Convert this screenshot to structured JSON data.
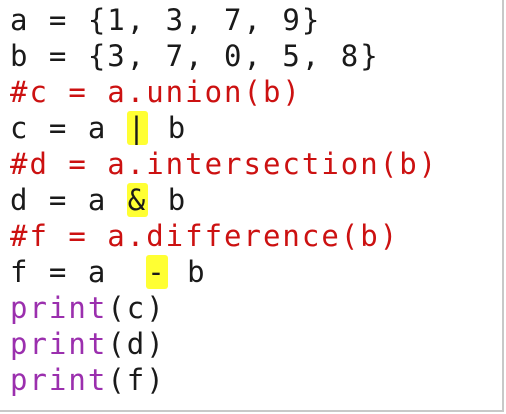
{
  "colors": {
    "default": "#1a1a1a",
    "comment": "#cc1111",
    "builtin": "#9b2fae",
    "highlight": "#ffff33"
  },
  "code_lines": [
    {
      "kind": "default",
      "segments": [
        {
          "text": "a = {1, 3, 7, 9}"
        }
      ]
    },
    {
      "kind": "default",
      "segments": [
        {
          "text": "b = {3, 7, 0, 5, 8}"
        }
      ]
    },
    {
      "kind": "comment",
      "segments": [
        {
          "text": "#c = a.union(b)"
        }
      ]
    },
    {
      "kind": "default",
      "segments": [
        {
          "text": "c = a "
        },
        {
          "text": "|",
          "highlight": true
        },
        {
          "text": " b"
        }
      ]
    },
    {
      "kind": "comment",
      "segments": [
        {
          "text": "#d = a.intersection(b)"
        }
      ]
    },
    {
      "kind": "default",
      "segments": [
        {
          "text": "d = a "
        },
        {
          "text": "&",
          "highlight": true
        },
        {
          "text": " b"
        }
      ]
    },
    {
      "kind": "comment",
      "segments": [
        {
          "text": "#f = a.difference(b)"
        }
      ]
    },
    {
      "kind": "default",
      "segments": [
        {
          "text": "f = a  "
        },
        {
          "text": "-",
          "highlight": true
        },
        {
          "text": " b"
        }
      ]
    },
    {
      "kind": "print",
      "segments": [
        {
          "text": "print",
          "color": "builtin"
        },
        {
          "text": "(c)"
        }
      ]
    },
    {
      "kind": "print",
      "segments": [
        {
          "text": "print",
          "color": "builtin"
        },
        {
          "text": "(d)"
        }
      ]
    },
    {
      "kind": "print",
      "segments": [
        {
          "text": "print",
          "color": "builtin"
        },
        {
          "text": "(f)"
        }
      ]
    }
  ]
}
